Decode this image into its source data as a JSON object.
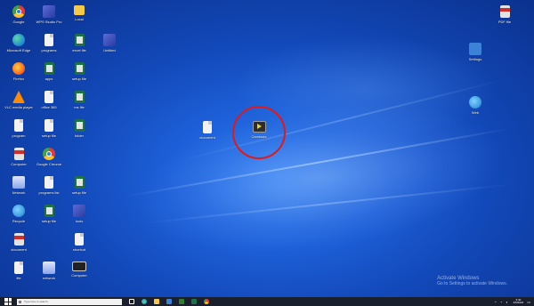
{
  "desktop": {
    "icons": [
      {
        "label": "Google",
        "type": "chrome",
        "col": 0,
        "row": 0
      },
      {
        "label": "WPS Studio Pro",
        "type": "app",
        "col": 1,
        "row": 0
      },
      {
        "label": "Local",
        "type": "folder",
        "col": 2,
        "row": 0
      },
      {
        "label": "Microsoft Edge",
        "type": "edge",
        "col": 0,
        "row": 1
      },
      {
        "label": "programs",
        "type": "doc",
        "col": 1,
        "row": 1
      },
      {
        "label": "excel file",
        "type": "excel",
        "col": 2,
        "row": 1
      },
      {
        "label": "Untitled",
        "type": "app",
        "col": 3,
        "row": 1
      },
      {
        "label": "Firefox",
        "type": "firefox",
        "col": 0,
        "row": 2
      },
      {
        "label": "apps",
        "type": "excel",
        "col": 1,
        "row": 2
      },
      {
        "label": "setup file",
        "type": "excel",
        "col": 2,
        "row": 2
      },
      {
        "label": "VLC media player",
        "type": "vlc",
        "col": 0,
        "row": 3
      },
      {
        "label": "office 365",
        "type": "doc",
        "col": 1,
        "row": 3
      },
      {
        "label": "ms file",
        "type": "excel",
        "col": 2,
        "row": 3
      },
      {
        "label": "program",
        "type": "doc",
        "col": 0,
        "row": 4
      },
      {
        "label": "setup file",
        "type": "doc",
        "col": 1,
        "row": 4
      },
      {
        "label": "folder",
        "type": "excel",
        "col": 2,
        "row": 4
      },
      {
        "label": "Computer",
        "type": "pdf",
        "col": 0,
        "row": 5
      },
      {
        "label": "Google Chrome",
        "type": "chrome",
        "col": 1,
        "row": 5
      },
      {
        "label": "Network",
        "type": "network",
        "col": 0,
        "row": 6
      },
      {
        "label": "programs list",
        "type": "doc",
        "col": 1,
        "row": 6
      },
      {
        "label": "setup file",
        "type": "excel",
        "col": 2,
        "row": 6
      },
      {
        "label": "Recycle",
        "type": "globe",
        "col": 0,
        "row": 7
      },
      {
        "label": "setup file",
        "type": "excel",
        "col": 1,
        "row": 7
      },
      {
        "label": "tools",
        "type": "app",
        "col": 2,
        "row": 7
      },
      {
        "label": "document",
        "type": "pdf",
        "col": 0,
        "row": 8
      },
      {
        "label": "shortcut",
        "type": "doc",
        "col": 2,
        "row": 8
      },
      {
        "label": "file",
        "type": "doc",
        "col": 0,
        "row": 9
      },
      {
        "label": "network",
        "type": "network",
        "col": 1,
        "row": 9
      },
      {
        "label": "Computer",
        "type": "monitor",
        "col": 2,
        "row": 9
      }
    ],
    "right_icons": [
      {
        "label": "PDF file",
        "type": "pdf",
        "pos": "top"
      },
      {
        "label": "Settings",
        "type": "settings",
        "pos": "second"
      },
      {
        "label": "Web",
        "type": "globe",
        "pos": "third"
      }
    ],
    "center_icons": [
      {
        "label": "document",
        "type": "doc",
        "pos": "left"
      },
      {
        "label": "Camtasia",
        "type": "video",
        "pos": "highlight"
      }
    ]
  },
  "watermark": {
    "title": "Activate Windows",
    "subtitle": "Go to Settings to activate Windows."
  },
  "taskbar": {
    "search_placeholder": "Type here to search",
    "tray_time": "3:40",
    "tray_date": "4/5/2022",
    "pinned": [
      "task-view",
      "edge",
      "explorer",
      "store",
      "mail",
      "excel",
      "chrome"
    ]
  },
  "colors": {
    "highlight_ring": "#e0191b",
    "taskbar_bg": "#1a1f2e"
  }
}
